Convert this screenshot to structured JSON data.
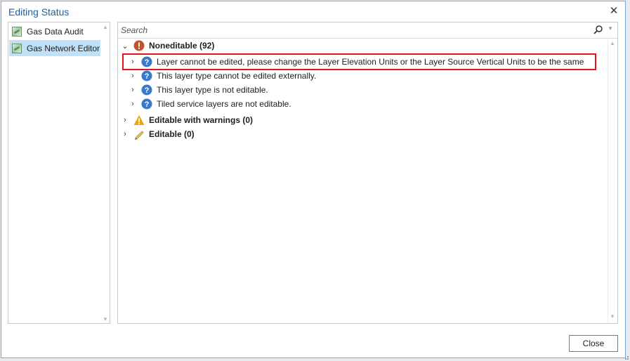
{
  "dialog": {
    "title": "Editing Status",
    "close_button_label": "Close"
  },
  "left_panel": {
    "items": [
      {
        "label": "Gas Data Audit",
        "selected": false
      },
      {
        "label": "Gas Network Editor",
        "selected": true
      }
    ]
  },
  "search": {
    "placeholder": "Search"
  },
  "tree": {
    "groups": [
      {
        "label": "Noneditable (92)",
        "icon": "error-icon",
        "expanded": true,
        "children": [
          {
            "label": "Layer cannot be edited, please change the Layer Elevation Units or the Layer Source Vertical Units to be the same",
            "icon": "question-icon",
            "highlighted": true
          },
          {
            "label": "This layer type cannot be edited externally.",
            "icon": "question-icon"
          },
          {
            "label": "This layer type is not editable.",
            "icon": "question-icon"
          },
          {
            "label": "Tiled service layers are not editable.",
            "icon": "question-icon"
          }
        ]
      },
      {
        "label": "Editable with warnings (0)",
        "icon": "warning-icon",
        "expanded": false
      },
      {
        "label": "Editable (0)",
        "icon": "pencil-icon",
        "expanded": false
      }
    ]
  },
  "colors": {
    "title": "#1a5fa8",
    "selection": "#bfe0f5",
    "highlight_border": "#e0141e",
    "error": "#c4512c",
    "question": "#3a78c9",
    "warning": "#f0a30a"
  }
}
